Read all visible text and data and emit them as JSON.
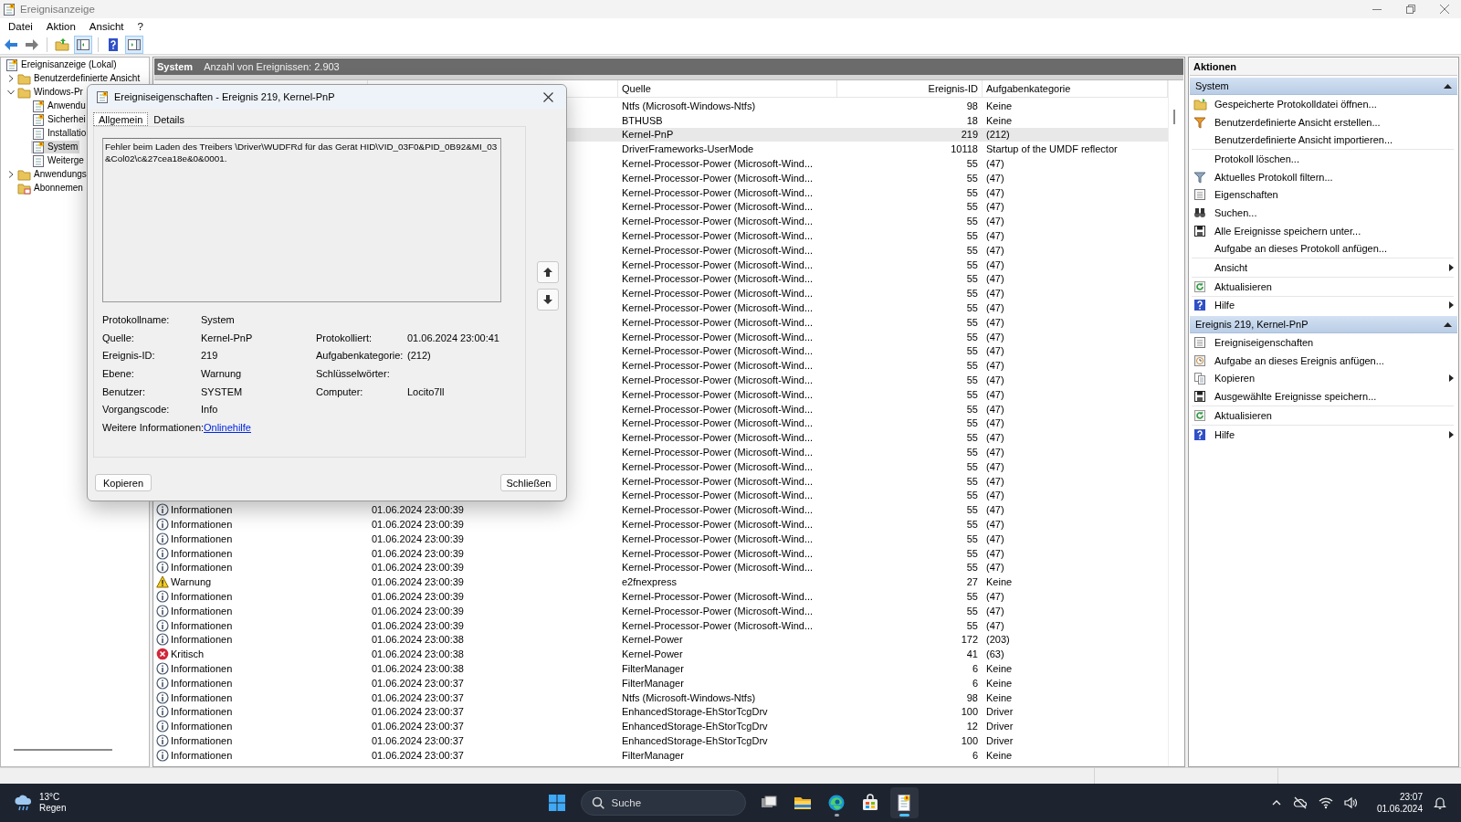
{
  "window": {
    "title": "Ereignisanzeige"
  },
  "menu": [
    "Datei",
    "Aktion",
    "Ansicht",
    "?"
  ],
  "toolbar": [
    {
      "kind": "back",
      "on": false
    },
    {
      "kind": "forward",
      "on": false
    },
    {
      "kind": "folder",
      "on": false
    },
    {
      "kind": "tree-pane",
      "on": true
    },
    {
      "kind": "help",
      "on": false
    },
    {
      "kind": "action-pane",
      "on": true
    }
  ],
  "tree": [
    {
      "label": "Ereignisanzeige (Lokal)",
      "kind": "root",
      "selected": false,
      "children": [
        {
          "label": "Benutzerdefinierte Ansicht",
          "kind": "folder",
          "expanded": false,
          "selected": false
        },
        {
          "label": "Windows-Pr",
          "kind": "folder",
          "expanded": true,
          "selected": false,
          "children": [
            {
              "label": "Anwendu",
              "kind": "log",
              "selected": false
            },
            {
              "label": "Sicherhei",
              "kind": "log",
              "selected": false
            },
            {
              "label": "Installatio",
              "kind": "plain-log",
              "selected": false
            },
            {
              "label": "System",
              "kind": "log",
              "selected": true
            },
            {
              "label": "Weiterge",
              "kind": "plain-log",
              "selected": false
            }
          ]
        },
        {
          "label": "Anwendungs",
          "kind": "folder",
          "expanded": false,
          "selected": false
        },
        {
          "label": "Abonnemen",
          "kind": "subscription",
          "selected": false
        }
      ]
    }
  ],
  "log_header": {
    "title": "System",
    "count": "Anzahl von Ereignissen: 2.903"
  },
  "table": {
    "column_headers": [
      "Quelle",
      "Ereignis-ID",
      "Aufgabenkategorie"
    ],
    "rows": [
      {
        "source": "Ntfs (Microsoft-Windows-Ntfs)",
        "id": "98",
        "category": "Keine",
        "selected": false
      },
      {
        "source": "BTHUSB",
        "id": "18",
        "category": "Keine",
        "selected": false
      },
      {
        "source": "Kernel-PnP",
        "id": "219",
        "category": "(212)",
        "selected": true
      },
      {
        "source": "DriverFrameworks-UserMode",
        "id": "10118",
        "category": "Startup of the UMDF reflector",
        "selected": false
      },
      {
        "source": "Kernel-Processor-Power (Microsoft-Wind...",
        "id": "55",
        "category": "(47)",
        "selected": false
      },
      {
        "source": "Kernel-Processor-Power (Microsoft-Wind...",
        "id": "55",
        "category": "(47)",
        "selected": false
      },
      {
        "source": "Kernel-Processor-Power (Microsoft-Wind...",
        "id": "55",
        "category": "(47)",
        "selected": false
      },
      {
        "source": "Kernel-Processor-Power (Microsoft-Wind...",
        "id": "55",
        "category": "(47)",
        "selected": false
      },
      {
        "source": "Kernel-Processor-Power (Microsoft-Wind...",
        "id": "55",
        "category": "(47)",
        "selected": false
      },
      {
        "source": "Kernel-Processor-Power (Microsoft-Wind...",
        "id": "55",
        "category": "(47)",
        "selected": false
      },
      {
        "source": "Kernel-Processor-Power (Microsoft-Wind...",
        "id": "55",
        "category": "(47)",
        "selected": false
      },
      {
        "source": "Kernel-Processor-Power (Microsoft-Wind...",
        "id": "55",
        "category": "(47)",
        "selected": false
      },
      {
        "source": "Kernel-Processor-Power (Microsoft-Wind...",
        "id": "55",
        "category": "(47)",
        "selected": false
      },
      {
        "source": "Kernel-Processor-Power (Microsoft-Wind...",
        "id": "55",
        "category": "(47)",
        "selected": false
      },
      {
        "source": "Kernel-Processor-Power (Microsoft-Wind...",
        "id": "55",
        "category": "(47)",
        "selected": false
      },
      {
        "source": "Kernel-Processor-Power (Microsoft-Wind...",
        "id": "55",
        "category": "(47)",
        "selected": false
      },
      {
        "source": "Kernel-Processor-Power (Microsoft-Wind...",
        "id": "55",
        "category": "(47)",
        "selected": false
      },
      {
        "source": "Kernel-Processor-Power (Microsoft-Wind...",
        "id": "55",
        "category": "(47)",
        "selected": false
      },
      {
        "source": "Kernel-Processor-Power (Microsoft-Wind...",
        "id": "55",
        "category": "(47)",
        "selected": false
      },
      {
        "source": "Kernel-Processor-Power (Microsoft-Wind...",
        "id": "55",
        "category": "(47)",
        "selected": false
      },
      {
        "source": "Kernel-Processor-Power (Microsoft-Wind...",
        "id": "55",
        "category": "(47)",
        "selected": false
      },
      {
        "source": "Kernel-Processor-Power (Microsoft-Wind...",
        "id": "55",
        "category": "(47)",
        "selected": false
      },
      {
        "source": "Kernel-Processor-Power (Microsoft-Wind...",
        "id": "55",
        "category": "(47)",
        "selected": false
      },
      {
        "source": "Kernel-Processor-Power (Microsoft-Wind...",
        "id": "55",
        "category": "(47)",
        "selected": false
      },
      {
        "source": "Kernel-Processor-Power (Microsoft-Wind...",
        "id": "55",
        "category": "(47)",
        "selected": false
      },
      {
        "source": "Kernel-Processor-Power (Microsoft-Wind...",
        "id": "55",
        "category": "(47)",
        "selected": false
      },
      {
        "source": "Kernel-Processor-Power (Microsoft-Wind...",
        "id": "55",
        "category": "(47)",
        "selected": false
      },
      {
        "source": "Kernel-Processor-Power (Microsoft-Wind...",
        "id": "55",
        "category": "(47)",
        "selected": false
      },
      {
        "kind": "info",
        "level": "Informationen",
        "date": "01.06.2024 23:00:39",
        "source": "Kernel-Processor-Power (Microsoft-Wind...",
        "id": "55",
        "category": "(47)",
        "selected": false
      },
      {
        "kind": "info",
        "level": "Informationen",
        "date": "01.06.2024 23:00:39",
        "source": "Kernel-Processor-Power (Microsoft-Wind...",
        "id": "55",
        "category": "(47)",
        "selected": false
      },
      {
        "kind": "info",
        "level": "Informationen",
        "date": "01.06.2024 23:00:39",
        "source": "Kernel-Processor-Power (Microsoft-Wind...",
        "id": "55",
        "category": "(47)",
        "selected": false
      },
      {
        "kind": "info",
        "level": "Informationen",
        "date": "01.06.2024 23:00:39",
        "source": "Kernel-Processor-Power (Microsoft-Wind...",
        "id": "55",
        "category": "(47)",
        "selected": false
      },
      {
        "kind": "info",
        "level": "Informationen",
        "date": "01.06.2024 23:00:39",
        "source": "Kernel-Processor-Power (Microsoft-Wind...",
        "id": "55",
        "category": "(47)",
        "selected": false
      },
      {
        "kind": "warning",
        "level": "Warnung",
        "date": "01.06.2024 23:00:39",
        "source": "e2fnexpress",
        "id": "27",
        "category": "Keine",
        "selected": false
      },
      {
        "kind": "info",
        "level": "Informationen",
        "date": "01.06.2024 23:00:39",
        "source": "Kernel-Processor-Power (Microsoft-Wind...",
        "id": "55",
        "category": "(47)",
        "selected": false
      },
      {
        "kind": "info",
        "level": "Informationen",
        "date": "01.06.2024 23:00:39",
        "source": "Kernel-Processor-Power (Microsoft-Wind...",
        "id": "55",
        "category": "(47)",
        "selected": false
      },
      {
        "kind": "info",
        "level": "Informationen",
        "date": "01.06.2024 23:00:39",
        "source": "Kernel-Processor-Power (Microsoft-Wind...",
        "id": "55",
        "category": "(47)",
        "selected": false
      },
      {
        "kind": "info",
        "level": "Informationen",
        "date": "01.06.2024 23:00:38",
        "source": "Kernel-Power",
        "id": "172",
        "category": "(203)",
        "selected": false
      },
      {
        "kind": "critical",
        "level": "Kritisch",
        "date": "01.06.2024 23:00:38",
        "source": "Kernel-Power",
        "id": "41",
        "category": "(63)",
        "selected": false
      },
      {
        "kind": "info",
        "level": "Informationen",
        "date": "01.06.2024 23:00:38",
        "source": "FilterManager",
        "id": "6",
        "category": "Keine",
        "selected": false
      },
      {
        "kind": "info",
        "level": "Informationen",
        "date": "01.06.2024 23:00:37",
        "source": "FilterManager",
        "id": "6",
        "category": "Keine",
        "selected": false
      },
      {
        "kind": "info",
        "level": "Informationen",
        "date": "01.06.2024 23:00:37",
        "source": "Ntfs (Microsoft-Windows-Ntfs)",
        "id": "98",
        "category": "Keine",
        "selected": false
      },
      {
        "kind": "info",
        "level": "Informationen",
        "date": "01.06.2024 23:00:37",
        "source": "EnhancedStorage-EhStorTcgDrv",
        "id": "100",
        "category": "Driver",
        "selected": false
      },
      {
        "kind": "info",
        "level": "Informationen",
        "date": "01.06.2024 23:00:37",
        "source": "EnhancedStorage-EhStorTcgDrv",
        "id": "12",
        "category": "Driver",
        "selected": false
      },
      {
        "kind": "info",
        "level": "Informationen",
        "date": "01.06.2024 23:00:37",
        "source": "EnhancedStorage-EhStorTcgDrv",
        "id": "100",
        "category": "Driver",
        "selected": false
      },
      {
        "kind": "info",
        "level": "Informationen",
        "date": "01.06.2024 23:00:37",
        "source": "FilterManager",
        "id": "6",
        "category": "Keine",
        "selected": false
      }
    ]
  },
  "actions": {
    "title": "Aktionen",
    "sections": [
      {
        "title": "System",
        "expanded": true,
        "items": [
          {
            "label": "Gespeicherte Protokolldatei öffnen...",
            "kind": "open",
            "separated": false,
            "submenu": false
          },
          {
            "label": "Benutzerdefinierte Ansicht erstellen...",
            "kind": "create-view",
            "separated": false,
            "submenu": false
          },
          {
            "label": "Benutzerdefinierte Ansicht importieren...",
            "kind": "blank",
            "separated": false,
            "submenu": false
          },
          {
            "label": "Protokoll löschen...",
            "kind": "blank",
            "separated": true,
            "submenu": false
          },
          {
            "label": "Aktuelles Protokoll filtern...",
            "kind": "filter",
            "separated": false,
            "submenu": false
          },
          {
            "label": "Eigenschaften",
            "kind": "properties",
            "separated": false,
            "submenu": false
          },
          {
            "label": "Suchen...",
            "kind": "find",
            "separated": false,
            "submenu": false
          },
          {
            "label": "Alle Ereignisse speichern unter...",
            "kind": "save",
            "separated": false,
            "submenu": false
          },
          {
            "label": "Aufgabe an dieses Protokoll anfügen...",
            "kind": "blank",
            "separated": false,
            "submenu": false
          },
          {
            "label": "Ansicht",
            "kind": "blank",
            "separated": true,
            "submenu": true
          },
          {
            "label": "Aktualisieren",
            "kind": "refresh",
            "separated": true,
            "submenu": false
          },
          {
            "label": "Hilfe",
            "kind": "help",
            "separated": true,
            "submenu": true
          }
        ]
      },
      {
        "title": "Ereignis 219, Kernel-PnP",
        "expanded": true,
        "items": [
          {
            "label": "Ereigniseigenschaften",
            "kind": "properties",
            "separated": false,
            "submenu": false
          },
          {
            "label": "Aufgabe an dieses Ereignis anfügen...",
            "kind": "task",
            "separated": false,
            "submenu": false
          },
          {
            "label": "Kopieren",
            "kind": "copy",
            "separated": false,
            "submenu": true
          },
          {
            "label": "Ausgewählte Ereignisse speichern...",
            "kind": "save",
            "separated": false,
            "submenu": false
          },
          {
            "label": "Aktualisieren",
            "kind": "refresh",
            "separated": true,
            "submenu": false
          },
          {
            "label": "Hilfe",
            "kind": "help",
            "separated": true,
            "submenu": true
          }
        ]
      }
    ]
  },
  "dialog": {
    "title": "Ereigniseigenschaften - Ereignis 219, Kernel-PnP",
    "tabs": [
      {
        "label": "Allgemein",
        "selected": true
      },
      {
        "label": "Details",
        "selected": false
      }
    ],
    "message": "Fehler beim Laden des Treibers \\Driver\\WUDFRd für das Gerät HID\\VID_03F0&PID_0B92&MI_03&Col02\\c&27cea18e&0&0001.",
    "field_rows": [
      [
        {
          "label": "Protokollname:",
          "value": "System"
        }
      ],
      [
        {
          "label": "Quelle:",
          "value": "Kernel-PnP"
        },
        {
          "label": "Protokolliert:",
          "value": "01.06.2024 23:00:41"
        }
      ],
      [
        {
          "label": "Ereignis-ID:",
          "value": "219"
        },
        {
          "label": "Aufgabenkategorie:",
          "value": "(212)"
        }
      ],
      [
        {
          "label": "Ebene:",
          "value": "Warnung"
        },
        {
          "label": "Schlüsselwörter:"
        }
      ],
      [
        {
          "label": "Benutzer:",
          "value": "SYSTEM"
        },
        {
          "label": "Computer:",
          "value": "Locito7ll"
        }
      ],
      [
        {
          "label": "Vorgangscode:",
          "value": "Info"
        }
      ],
      [
        {
          "label": "Weitere Informationen:",
          "link": "Onlinehilfe"
        }
      ]
    ],
    "buttons": [
      "Kopieren",
      "Schließen"
    ]
  },
  "taskbar": {
    "weather": {
      "temperature": "13°C",
      "condition": "Regen"
    },
    "search": {
      "placeholder": "Suche"
    },
    "apps": [
      {
        "kind": "task-view",
        "running": false,
        "active": false
      },
      {
        "kind": "explorer",
        "running": false,
        "active": false
      },
      {
        "kind": "edge",
        "running": true,
        "active": false
      },
      {
        "kind": "store",
        "running": false,
        "active": false
      },
      {
        "kind": "event-viewer",
        "running": true,
        "active": true
      }
    ],
    "clock": {
      "time": "23:07",
      "date": "01.06.2024"
    }
  }
}
